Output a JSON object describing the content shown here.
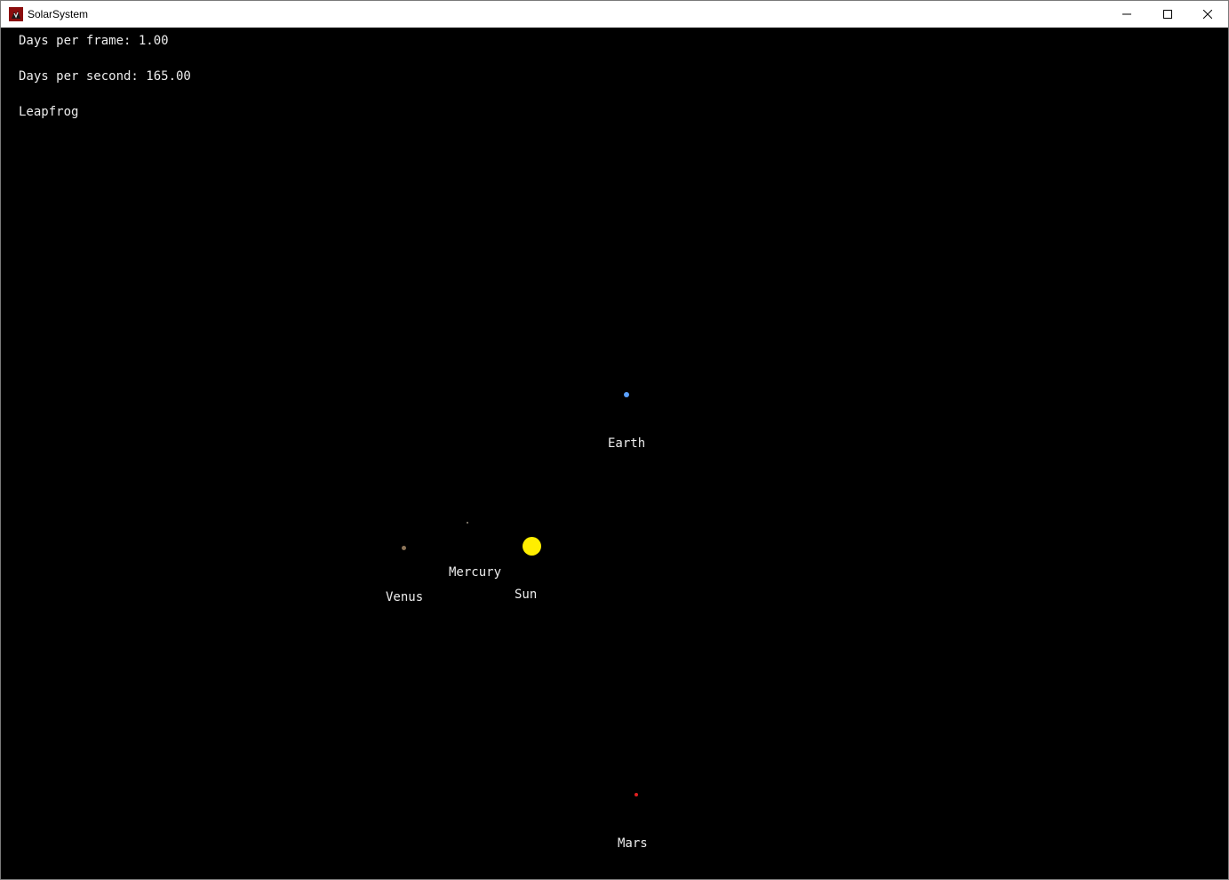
{
  "window": {
    "title": "SolarSystem",
    "controls": {
      "minimize": "minimize-icon",
      "maximize": "maximize-icon",
      "close": "close-icon"
    }
  },
  "hud": {
    "days_per_frame": "Days per frame: 1.00",
    "days_per_second": "Days per second: 165.00",
    "integrator": "Leapfrog"
  },
  "bodies": {
    "sun": {
      "label": "Sun",
      "color": "#ffee00"
    },
    "mercury": {
      "label": "Mercury",
      "color": "#9a8f80"
    },
    "venus": {
      "label": "Venus",
      "color": "#8c7458"
    },
    "earth": {
      "label": "Earth",
      "color": "#5aa0ff"
    },
    "mars": {
      "label": "Mars",
      "color": "#e02020"
    }
  },
  "colors": {
    "background": "#000000",
    "text": "#ececec"
  }
}
